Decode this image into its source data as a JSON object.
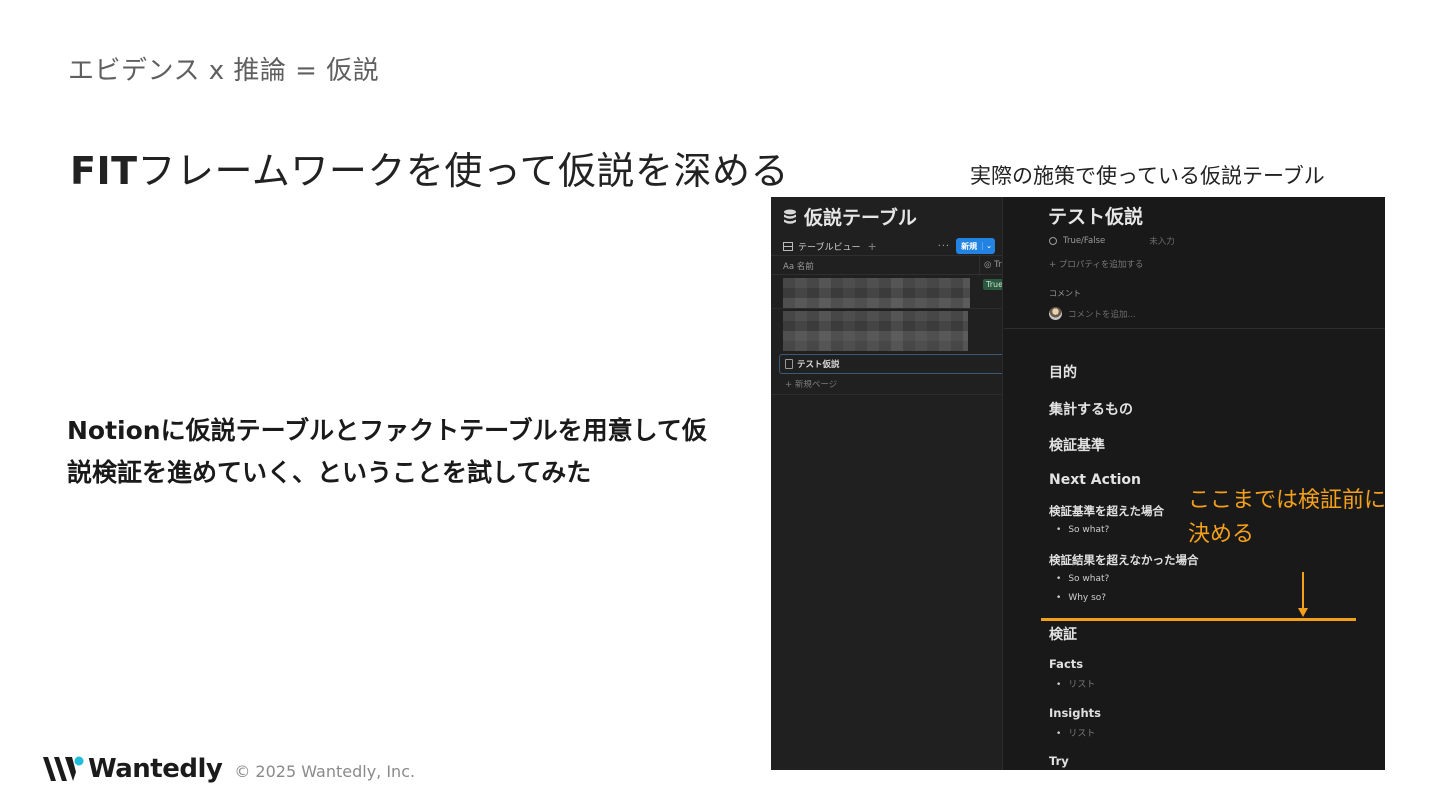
{
  "slide": {
    "section_title": "エビデンス x 推論 = 仮説",
    "title_bold": "FIT",
    "title_rest": "フレームワークを使って仮説を深める",
    "body_line1": "Notionに仮説テーブルとファクトテーブルを用意して仮",
    "body_line2": "説検証を進めていく、ということを試してみた",
    "screenshot_caption": "実際の施策で使っている仮説テーブル"
  },
  "notion_left": {
    "db_title": "仮説テーブル",
    "view_name": "テーブルビュー",
    "add_view": "+",
    "more": "···",
    "new_button": "新規",
    "new_chevron": "⌄",
    "col_name_prefix": "Aa",
    "col_name": "名前",
    "col2_label": "Tr",
    "true_tag": "True",
    "page_item": "テスト仮説",
    "new_page": "+ 新規ページ"
  },
  "notion_right": {
    "page_title": "テスト仮説",
    "prop_name": "True/False",
    "prop_value": "未入力",
    "add_property": "+ プロパティを追加する",
    "comment_label": "コメント",
    "comment_placeholder": "コメントを追加...",
    "heading_purpose": "目的",
    "heading_aggregate": "集計するもの",
    "heading_criteria": "検証基準",
    "heading_next_action": "Next Action",
    "sub_exceeded": "検証基準を超えた場合",
    "bullet_so_what_1": "So what?",
    "sub_not_exceeded": "検証結果を超えなかった場合",
    "bullet_so_what_2": "So what?",
    "bullet_why_so": "Why so?",
    "heading_verification": "検証",
    "sub_facts": "Facts",
    "bullet_list_1": "リスト",
    "sub_insights": "Insights",
    "bullet_list_2": "リスト",
    "sub_try": "Try"
  },
  "annotation": {
    "line1": "ここまでは検証前に",
    "line2": "決める",
    "color": "#f5a01a"
  },
  "footer": {
    "brand": "Wantedly",
    "copyright": "© 2025 Wantedly, Inc."
  },
  "colors": {
    "notion_bg": "#191919",
    "notion_sidebar_bg": "#202020",
    "new_button_blue": "#2383e2",
    "true_tag_green": "#2b593f",
    "wantedly_blue": "#21bddb"
  }
}
